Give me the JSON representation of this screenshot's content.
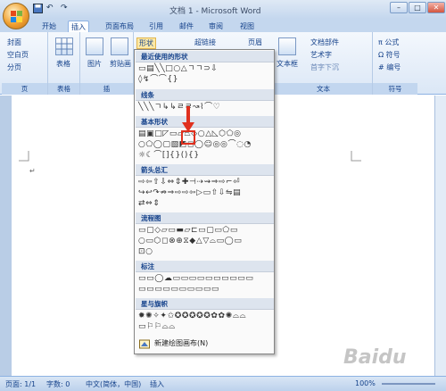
{
  "window": {
    "title": "文档 1 - Microsoft Word",
    "controls": [
      "–",
      "□",
      "✕"
    ]
  },
  "quick_access": {
    "save_icon": "save-icon",
    "undo_label": "↶",
    "redo_label": "↷"
  },
  "tabs": [
    "开始",
    "插入",
    "页面布局",
    "引用",
    "邮件",
    "审阅",
    "视图"
  ],
  "active_tab": "插入",
  "ribbon": {
    "pages_group": {
      "items": [
        "封面",
        "空白页",
        "分页"
      ],
      "label": "页"
    },
    "table_group": {
      "button": "表格",
      "label": "表格"
    },
    "illustrations_group": {
      "picture": "图片",
      "clipart": "剪贴画",
      "shapes": "形状",
      "label": "插"
    },
    "links_group": {
      "hyperlink": "超链接"
    },
    "header_group": {
      "header": "页眉"
    },
    "text_group": {
      "textbox": "文本框",
      "quickparts": "文档部件",
      "wordart": "艺术字",
      "dropcap": "首字下沉",
      "label": "文本"
    },
    "symbols_group": {
      "equation": "π 公式",
      "symbol": "Ω 符号",
      "number": "# 编号",
      "label": "符号"
    }
  },
  "shapes_menu": {
    "sections": [
      {
        "title": "最近使用的形状",
        "rows": [
          "▭▤╲╲□○△ㄱㄱ⊃⇩",
          "◊↯⌒⌒{}"
        ]
      },
      {
        "title": "线条",
        "rows": [
          "╲╲╲ㄱ↳↳ㄹㄹ↝⌇⌒♡"
        ]
      },
      {
        "title": "基本形状",
        "rows": [
          "▤▣□◸▭▱⏢◇○△◺⬡⬠◎",
          "○⬠◯▢▧◩◻◯☺◎◎⌒◌◔",
          "☼☾⌒[]{}(){}",
          ""
        ]
      },
      {
        "title": "箭头总汇",
        "rows": [
          "⇨⇦⇧⇩⇔⇕✚⊣⇢⇝⇒⇨⌐⏎",
          "↪↩↷⇏⇒⇨⇨⇦▷▭⇧⇩⇋▤",
          "⇄⇔⇕"
        ]
      },
      {
        "title": "流程图",
        "rows": [
          "▭▢◇▱▭▬⏥⊏▭▢▭⬠▭",
          "○▭⬡◻⊗⊕⧖◆△▽⌓▭◯▭",
          "⊡○"
        ]
      },
      {
        "title": "标注",
        "rows": [
          "▭▭◯☁▭▭▭▭▭▭▭▭▭▭",
          "▭▭▭▭▭▭▭▭▭▭"
        ]
      },
      {
        "title": "星与旗帜",
        "rows": [
          "✹✺✧✦✩✪✪✪✪✪✿✿✺⌓⌓",
          "▭⚐⚐⌓⌓"
        ]
      }
    ],
    "new_canvas_label": "新建绘图画布(N)"
  },
  "status": {
    "page": "页面: 1/1",
    "words": "字数: 0",
    "language": "中文(简体，中国)",
    "mode": "插入",
    "zoom": "100%"
  },
  "watermark": "Baidu",
  "colors": {
    "ribbon_bg": "#dbe7f6",
    "accent": "#15428b",
    "highlight": "#e0301e"
  }
}
